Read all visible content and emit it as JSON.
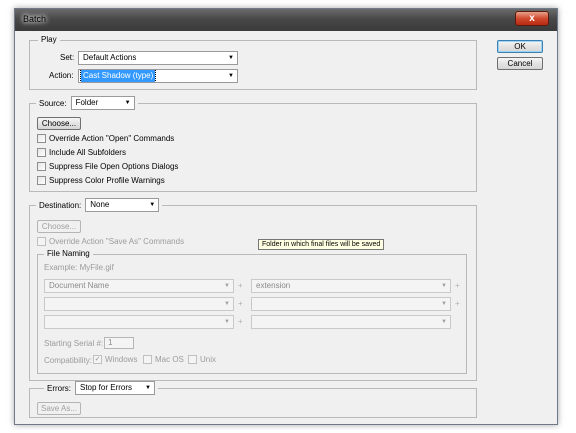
{
  "window": {
    "title": "Batch",
    "close_glyph": "x"
  },
  "buttons": {
    "ok": "OK",
    "cancel": "Cancel"
  },
  "play": {
    "legend": "Play",
    "set_label": "Set:",
    "set_value": "Default Actions",
    "action_label": "Action:",
    "action_value": "Cast Shadow (type)"
  },
  "source": {
    "label": "Source:",
    "value": "Folder",
    "choose": "Choose...",
    "options": [
      "Override Action \"Open\" Commands",
      "Include All Subfolders",
      "Suppress File Open Options Dialogs",
      "Suppress Color Profile Warnings"
    ]
  },
  "destination": {
    "label": "Destination:",
    "value": "None",
    "choose": "Choose...",
    "override_save_as": "Override Action \"Save As\" Commands",
    "tooltip": "Folder in which final files will be saved"
  },
  "file_naming": {
    "legend": "File Naming",
    "example": "Example: MyFile.gif",
    "fields": [
      [
        "Document Name",
        "extension"
      ],
      [
        "",
        ""
      ],
      [
        "",
        ""
      ]
    ],
    "plus": "+",
    "serial_label": "Starting Serial #:",
    "serial_value": "1",
    "compat_label": "Compatibility:",
    "compat_windows": "Windows",
    "compat_macos": "Mac OS",
    "compat_unix": "Unix"
  },
  "errors": {
    "label": "Errors:",
    "value": "Stop for Errors",
    "save_as": "Save As..."
  },
  "icons": {
    "dropdown": "chevron-down-icon",
    "close": "close-icon"
  },
  "colors": {
    "selection": "#3399ff",
    "tooltip_bg": "#ffffe1",
    "close_red": "#d04a2e"
  }
}
